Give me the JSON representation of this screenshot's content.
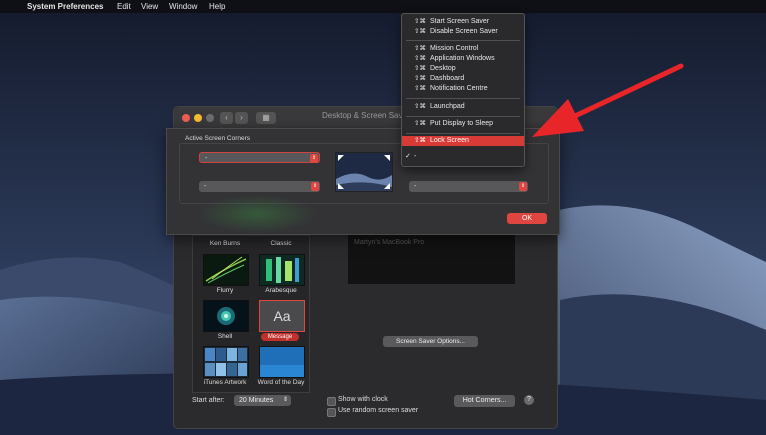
{
  "menubar": {
    "apple": "",
    "app": "System Preferences",
    "items": [
      "Edit",
      "View",
      "Window",
      "Help"
    ]
  },
  "window": {
    "title": "Desktop & Screen Saver",
    "savers": [
      {
        "label": "Ken Burns"
      },
      {
        "label": "Classic"
      },
      {
        "label": "Flurry"
      },
      {
        "label": "Arabesque"
      },
      {
        "label": "Shell"
      },
      {
        "label": "Message",
        "thumb_text": "Aa"
      },
      {
        "label": "iTunes Artwork"
      },
      {
        "label": "Word of the Day"
      }
    ],
    "preview_caption": "Martyn's MacBook Pro",
    "screen_saver_options": "Screen Saver Options...",
    "start_after_label": "Start after:",
    "start_after_value": "20 Minutes",
    "show_with_clock": "Show with clock",
    "use_random": "Use random screen saver",
    "hot_corners": "Hot Corners...",
    "help": "?"
  },
  "sheet": {
    "title": "Active Screen Corners",
    "top_left": "-",
    "bottom_left": "-",
    "bottom_right": "-",
    "ok": "OK"
  },
  "menu": {
    "modifier": "⇧⌘",
    "groups": [
      [
        "Start Screen Saver",
        "Disable Screen Saver"
      ],
      [
        "Mission Control",
        "Application Windows",
        "Desktop",
        "Dashboard",
        "Notification Centre"
      ],
      [
        "Launchpad"
      ],
      [
        "Put Display to Sleep"
      ],
      [
        "Lock Screen"
      ]
    ],
    "selected_label": "-",
    "check": "✓"
  },
  "colors": {
    "accent": "#e0453f",
    "arrow": "#e8262a"
  }
}
